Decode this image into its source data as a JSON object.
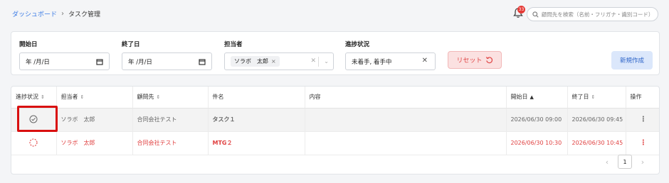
{
  "breadcrumb": {
    "parent": "ダッシュボード",
    "separator": "›",
    "current": "タスク管理"
  },
  "header": {
    "notification_count": "33",
    "search_placeholder": "顧問先を検索（名前・フリガナ・識別コード）"
  },
  "filters": {
    "start_date": {
      "label": "開始日",
      "value": "年 /月/日"
    },
    "end_date": {
      "label": "終了日",
      "value": "年 /月/日"
    },
    "assignee": {
      "label": "担当者",
      "chip": "ソラボ　太郎"
    },
    "status": {
      "label": "進捗状況",
      "value": "未着手, 着手中"
    },
    "reset_label": "リセット",
    "create_label": "新規作成"
  },
  "table": {
    "headers": {
      "status": "進捗状況",
      "assignee": "担当者",
      "client": "顧問先",
      "name": "件名",
      "content": "内容",
      "start": "開始日",
      "end": "終了日",
      "action": "操作"
    },
    "rows": [
      {
        "status_icon": "check-circle-icon",
        "assignee": "ソラボ　太郎",
        "client": "合同会社テスト",
        "name": "タスク１",
        "content": "",
        "start": "2026/06/30 09:00",
        "end": "2026/06/30 09:45",
        "state": "done"
      },
      {
        "status_icon": "dashed-circle-icon",
        "assignee": "ソラボ　太郎",
        "client": "合同会社テスト",
        "name": "MTG２",
        "content": "",
        "start": "2026/06/30 10:30",
        "end": "2026/06/30 10:45",
        "state": "pending"
      }
    ]
  },
  "pagination": {
    "current_page": "1",
    "prev": "‹",
    "next": "›"
  },
  "colors": {
    "accent": "#3b7be6",
    "danger": "#e04040",
    "highlight": "#d90f0f"
  }
}
